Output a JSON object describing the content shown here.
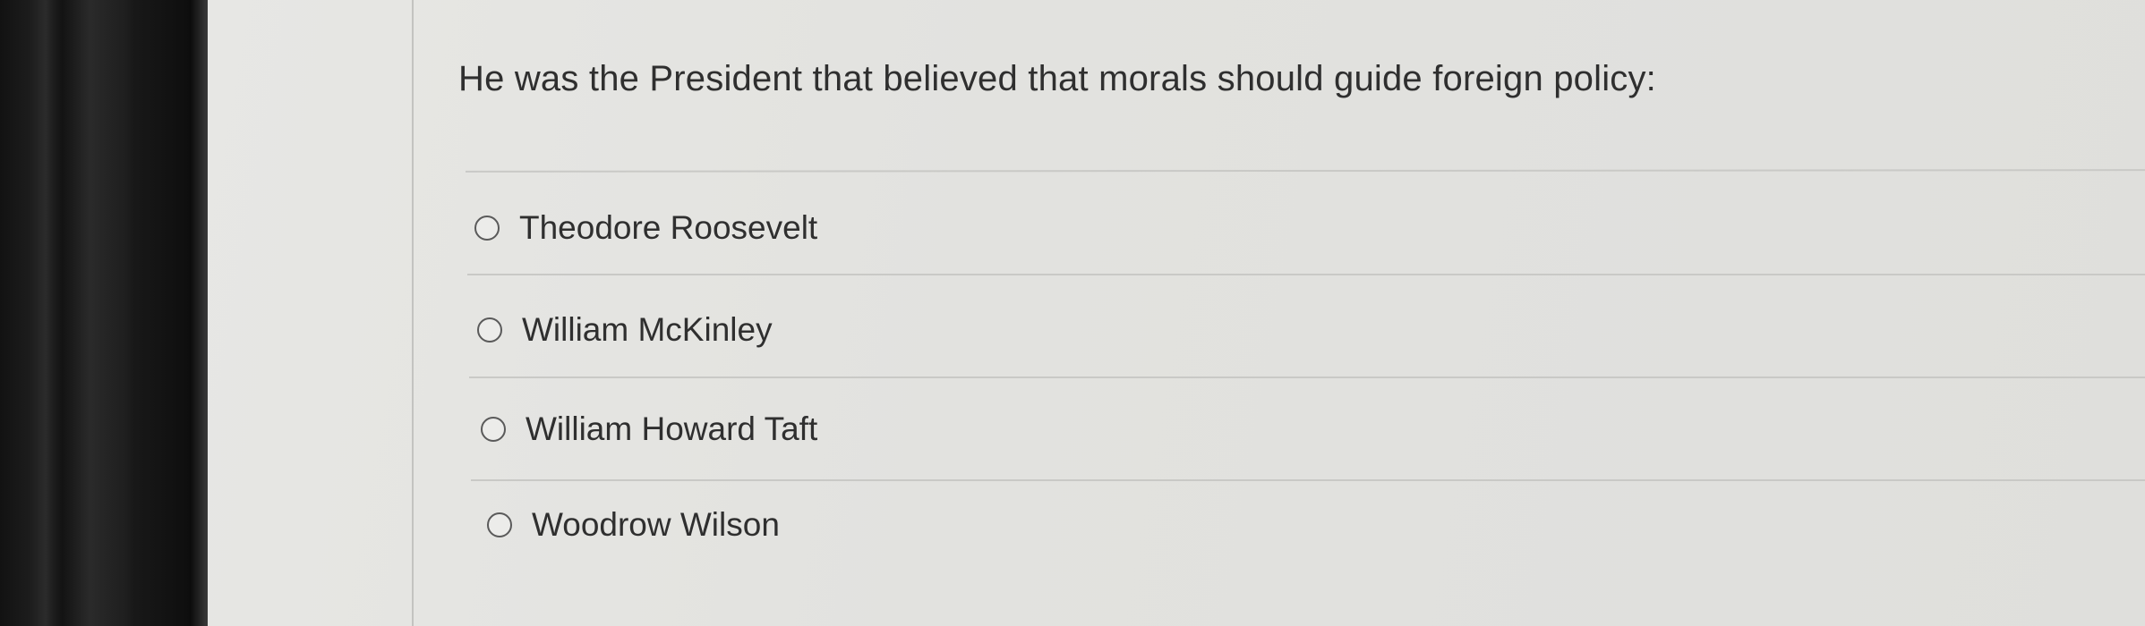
{
  "question": {
    "text": "He was the President that believed that morals should guide foreign policy:"
  },
  "options": [
    {
      "label": "Theodore Roosevelt",
      "selected": false
    },
    {
      "label": "William McKinley",
      "selected": false
    },
    {
      "label": "William Howard Taft",
      "selected": false
    },
    {
      "label": "Woodrow Wilson",
      "selected": false
    }
  ],
  "colors": {
    "background": "#e2e2df",
    "text": "#2f2f2f",
    "divider": "#c9c9c6",
    "radio_border": "#5a5a5a"
  }
}
